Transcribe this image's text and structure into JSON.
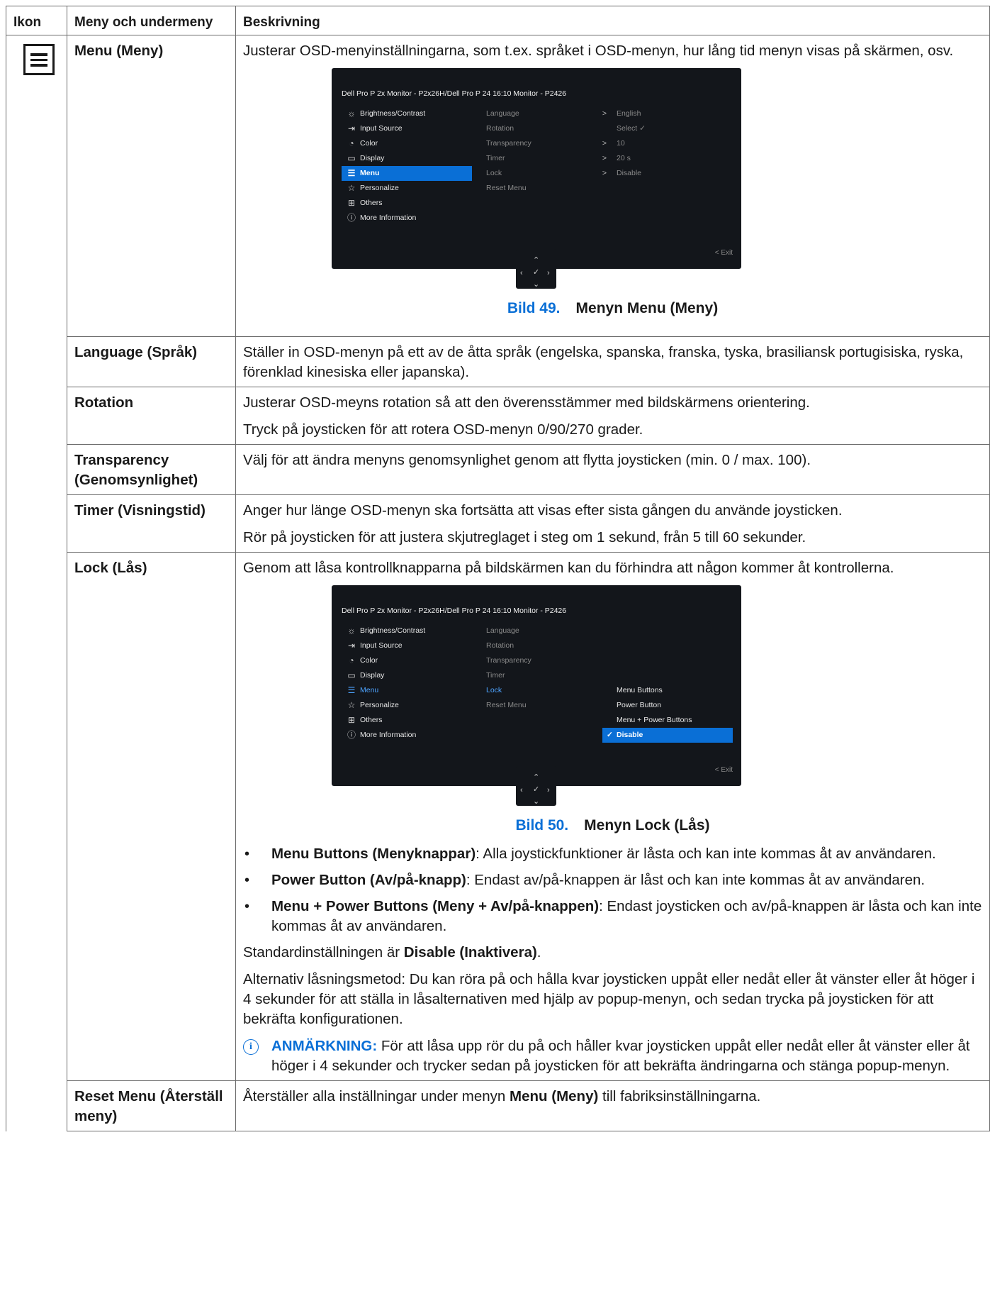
{
  "table": {
    "headers": {
      "icon": "Ikon",
      "menu": "Meny och undermeny",
      "desc": "Beskrivning"
    },
    "menu_row": {
      "label": "Menu (Meny)",
      "desc": "Justerar OSD-menyinställningarna, som t.ex. språket i OSD-menyn, hur lång tid menyn visas på skärmen, osv.",
      "figure_number": "Bild 49.",
      "figure_caption": "Menyn Menu (Meny)"
    },
    "language_row": {
      "label": "Language (Språk)",
      "desc": "Ställer in OSD-menyn på ett av de åtta språk (engelska, spanska, franska, tyska, brasiliansk portugisiska, ryska, förenklad kinesiska eller japanska)."
    },
    "rotation_row": {
      "label": "Rotation",
      "desc1": "Justerar OSD-meyns rotation så att den överensstämmer med bildskärmens orientering.",
      "desc2": "Tryck på joysticken för att rotera OSD-menyn 0/90/270 grader."
    },
    "transparency_row": {
      "label": "Transparency (Genomsynlighet)",
      "desc": "Välj för att ändra menyns genomsynlighet genom att flytta joysticken (min. 0 / max. 100)."
    },
    "timer_row": {
      "label": "Timer (Visningstid)",
      "desc1": "Anger hur länge OSD-menyn ska fortsätta att visas efter sista gången du använde joysticken.",
      "desc2": "Rör på joysticken för att justera skjutreglaget i steg om 1 sekund, från 5 till 60 sekunder."
    },
    "lock_row": {
      "label": "Lock (Lås)",
      "desc": "Genom att låsa kontrollknapparna på bildskärmen kan du förhindra att någon kommer åt kontrollerna.",
      "figure_number": "Bild 50.",
      "figure_caption": "Menyn Lock (Lås)",
      "bullets": [
        {
          "term": "Menu Buttons (Menyknappar)",
          "text": ": Alla joystickfunktioner är låsta och kan inte kommas åt av användaren."
        },
        {
          "term": "Power Button (Av/på-knapp)",
          "text": ": Endast av/på-knappen är låst och kan inte kommas åt av användaren."
        },
        {
          "term": "Menu + Power Buttons (Meny + Av/på-knappen)",
          "text": ": Endast joysticken och av/på-knappen är låsta och kan inte kommas åt av användaren."
        }
      ],
      "default_pre": "Standardinställningen är ",
      "default_val": "Disable (Inaktivera)",
      "default_post": ".",
      "alt": "Alternativ låsningsmetod: Du kan röra på och hålla kvar joysticken uppåt eller nedåt eller åt vänster eller åt höger i 4 sekunder för att ställa in låsalternativen med hjälp av popup-menyn, och sedan trycka på joysticken för att bekräfta konfigurationen.",
      "note_label": "ANMÄRKNING:",
      "note_text": " För att låsa upp rör du på och håller kvar joysticken uppåt eller nedåt eller åt vänster eller åt höger i 4 sekunder och trycker sedan på joysticken för att bekräfta ändringarna och stänga popup-menyn."
    },
    "reset_row": {
      "label": "Reset Menu (Återställ meny)",
      "desc_pre": "Återställer alla inställningar under menyn ",
      "desc_bold": "Menu (Meny)",
      "desc_post": " till fabriksinställningarna."
    }
  },
  "osd": {
    "title": "Dell Pro P 2x Monitor - P2x26H/Dell Pro P 24 16:10 Monitor - P2426",
    "left_items": [
      {
        "label": "Brightness/Contrast",
        "icon": "sun-icon"
      },
      {
        "label": "Input Source",
        "icon": "input-icon"
      },
      {
        "label": "Color",
        "icon": "palette-icon"
      },
      {
        "label": "Display",
        "icon": "monitor-icon"
      },
      {
        "label": "Menu",
        "icon": "menu-icon"
      },
      {
        "label": "Personalize",
        "icon": "star-icon"
      },
      {
        "label": "Others",
        "icon": "others-icon"
      },
      {
        "label": "More Information",
        "icon": "info-icon"
      }
    ],
    "menu_items": [
      "Language",
      "Rotation",
      "Transparency",
      "Timer",
      "Lock",
      "Reset Menu"
    ],
    "menu_values": [
      "English",
      "Select ✓",
      "10",
      "20 s",
      "Disable"
    ],
    "lock_options": [
      "Menu Buttons",
      "Power Button",
      "Menu + Power Buttons",
      "Disable"
    ],
    "exit_label": "Exit"
  }
}
